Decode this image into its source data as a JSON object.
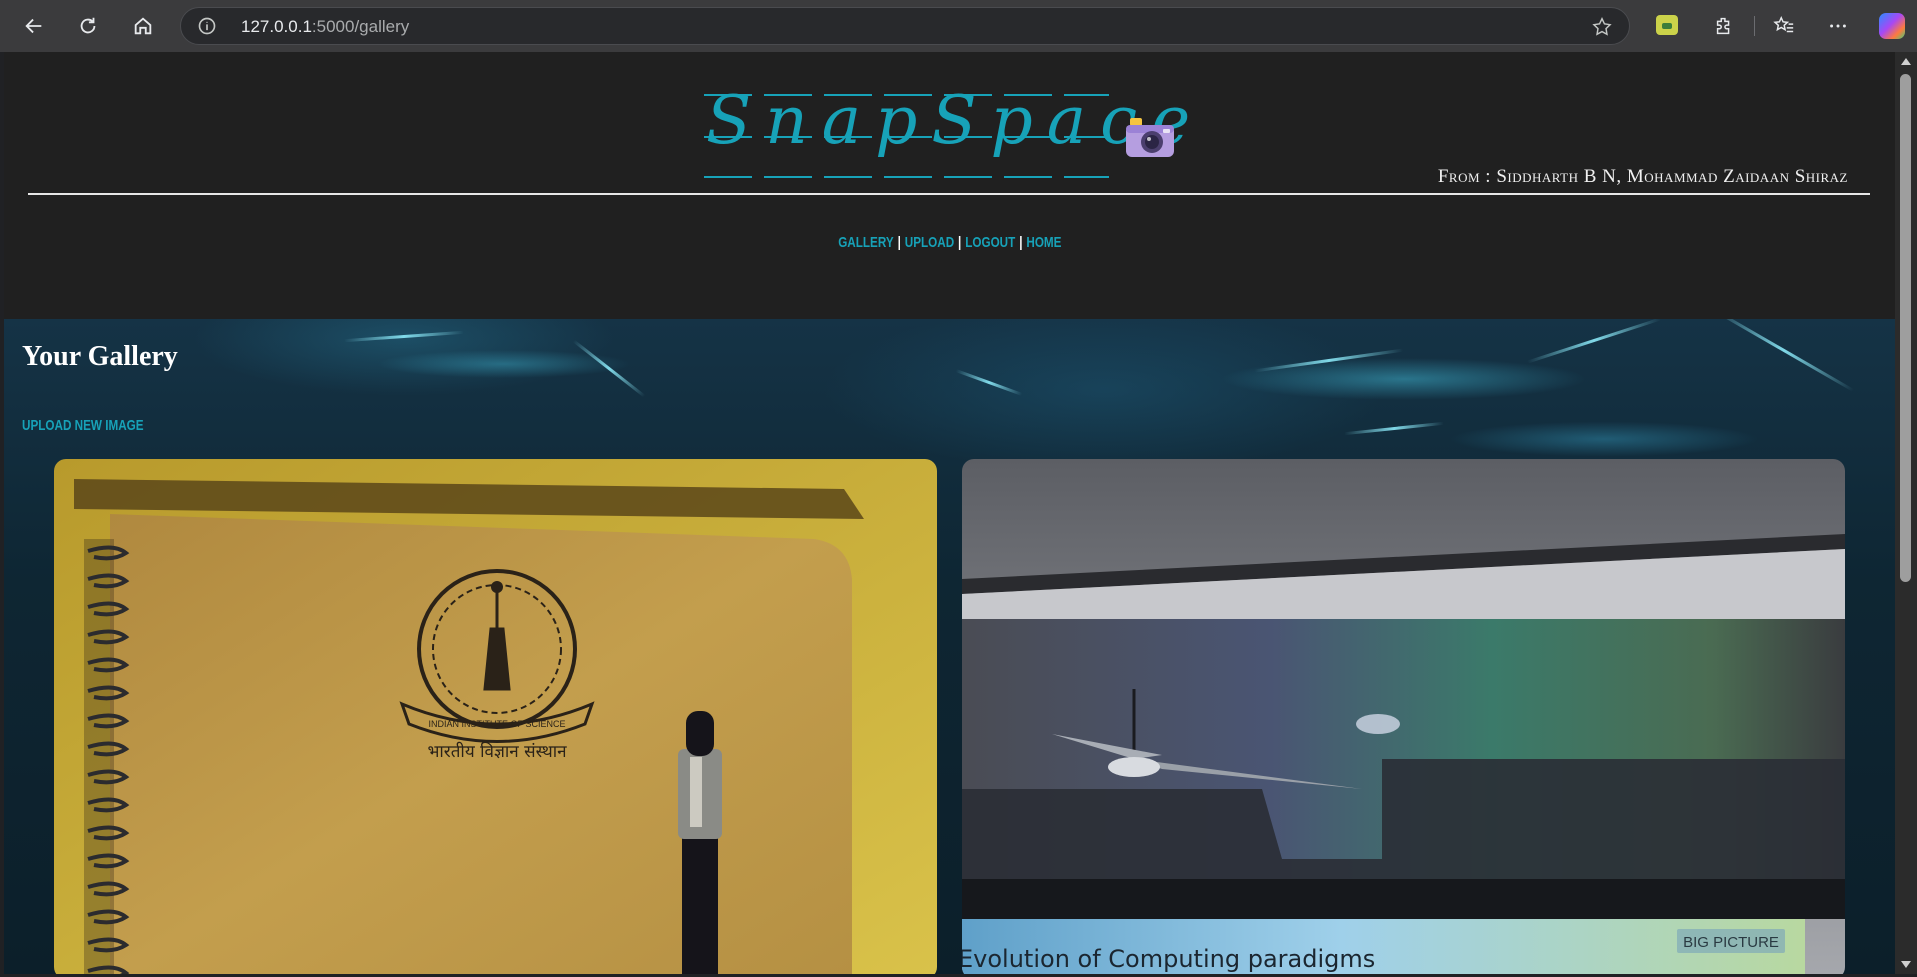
{
  "browser": {
    "url_host": "127.0.0.1",
    "url_path": ":5000/gallery"
  },
  "site": {
    "logo_text": "SnapSpace",
    "credits": "From : Siddharth B N, Mohammad Zaidaan Shiraz",
    "accent_color": "#17a2b8"
  },
  "nav": {
    "items": [
      {
        "label": "Gallery"
      },
      {
        "label": "Upload"
      },
      {
        "label": "Logout"
      },
      {
        "label": "Home"
      }
    ],
    "separator": "|"
  },
  "gallery": {
    "title": "Your Gallery",
    "upload_link": "Upload New Image",
    "images": [
      {
        "subject": "notebook",
        "caption_text": "भारतीय विज्ञान संस्थान",
        "emblem_ring_text": "INDIAN INSTITUTE OF SCIENCE"
      },
      {
        "subject": "lecture-hall",
        "slide_title": "Evolution of Computing paradigms",
        "slide_badge": "BIG PICTURE"
      }
    ]
  }
}
